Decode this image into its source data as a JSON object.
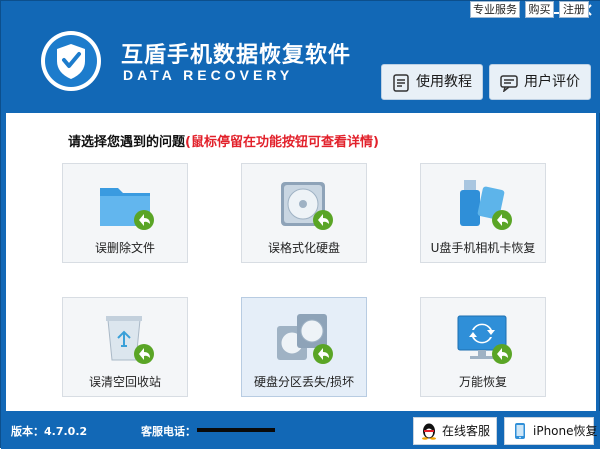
{
  "app": {
    "title": "互盾手机数据恢复软件",
    "subtitle": "DATA RECOVERY",
    "logo": "shield-check-logo"
  },
  "window_controls": {
    "minimize": "minimize-icon",
    "close": "close-icon"
  },
  "top_links": [
    {
      "label": "专业服务"
    },
    {
      "label": "购买"
    },
    {
      "label": "注册"
    }
  ],
  "header_buttons": [
    {
      "label": "使用教程",
      "icon": "document-icon"
    },
    {
      "label": "用户评价",
      "icon": "chat-icon"
    }
  ],
  "main": {
    "prompt": "请选择您遇到的问题",
    "hint": "(鼠标停留在功能按钮可查看详情)",
    "tiles": [
      {
        "label": "误删除文件",
        "icon": "folder-restore-icon",
        "selected": false
      },
      {
        "label": "误格式化硬盘",
        "icon": "disk-restore-icon",
        "selected": false
      },
      {
        "label": "U盘手机相机卡恢复",
        "icon": "usb-card-restore-icon",
        "selected": false
      },
      {
        "label": "误清空回收站",
        "icon": "recycle-bin-restore-icon",
        "selected": false
      },
      {
        "label": "硬盘分区丢失/损坏",
        "icon": "partition-restore-icon",
        "selected": true
      },
      {
        "label": "万能恢复",
        "icon": "monitor-refresh-icon",
        "selected": false
      }
    ]
  },
  "footer": {
    "version": "版本：4.7.0.2",
    "phone_label": "客服电话：",
    "buttons": [
      {
        "label": "在线客服",
        "icon": "qq-penguin-icon"
      },
      {
        "label": "iPhone恢复",
        "icon": "iphone-icon"
      }
    ]
  },
  "colors": {
    "brand_blue": "#1268b6",
    "hint_red": "#e2212b",
    "restore_arrow_green": "#5aa526"
  }
}
